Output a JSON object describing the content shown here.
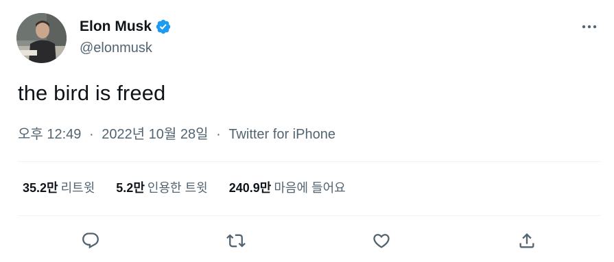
{
  "author": {
    "display_name": "Elon Musk",
    "handle": "@elonmusk",
    "verified": true,
    "verified_color": "#1d9bf0"
  },
  "tweet": {
    "text": "the bird is freed"
  },
  "meta": {
    "time": "오후 12:49",
    "separator": "·",
    "date": "2022년 10월 28일",
    "source": "Twitter for iPhone"
  },
  "stats": [
    {
      "count": "35.2만",
      "label": "리트윗"
    },
    {
      "count": "5.2만",
      "label": "인용한 트윗"
    },
    {
      "count": "240.9만",
      "label": "마음에 들어요"
    }
  ],
  "icons": {
    "more": "more-icon",
    "reply": "reply-icon",
    "retweet": "retweet-icon",
    "like": "like-icon",
    "share": "share-icon"
  },
  "colors": {
    "text": "#0f1419",
    "secondary": "#536471",
    "divider": "#eff3f4"
  }
}
